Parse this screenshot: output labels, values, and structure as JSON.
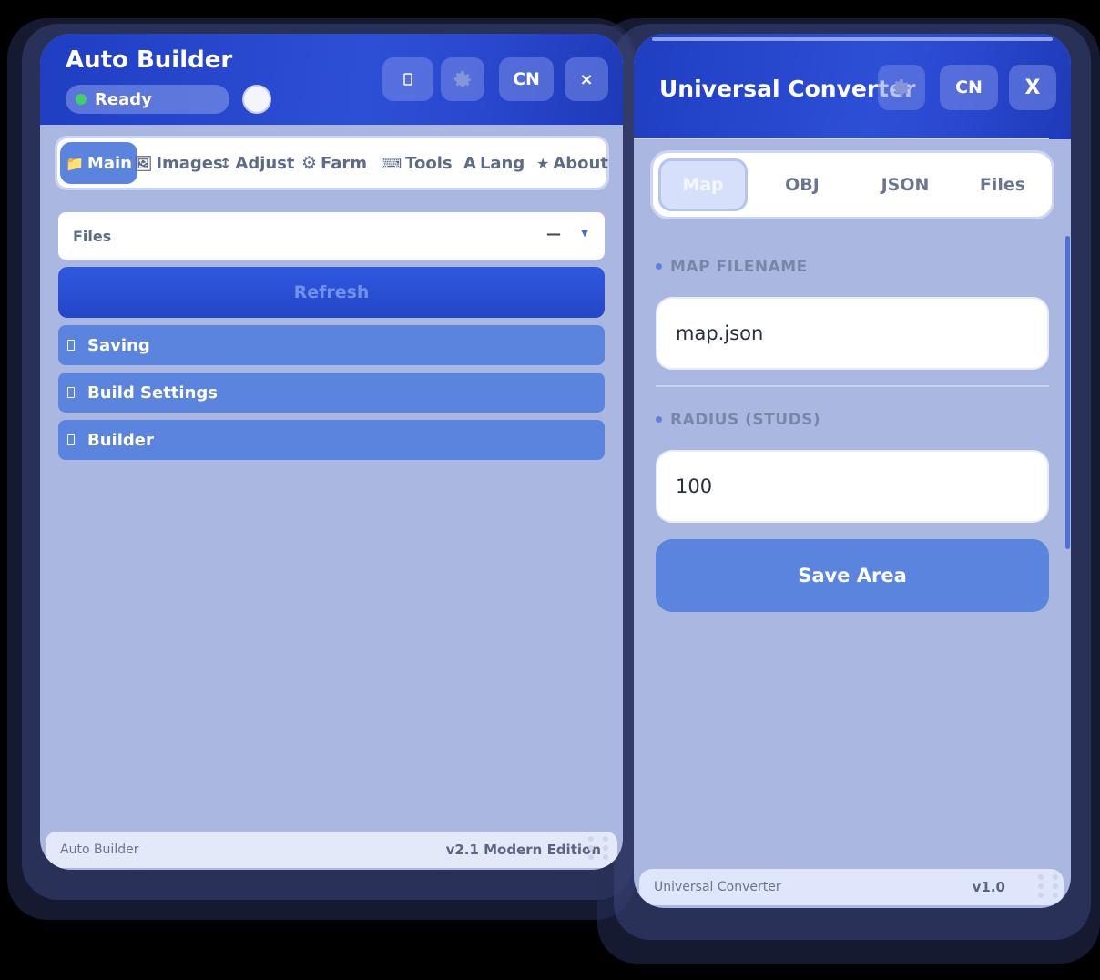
{
  "left_window": {
    "title": "Auto Builder",
    "status": "Ready",
    "header_buttons": {
      "mobile_icon": "phone-icon",
      "settings_icon": "gear-icon",
      "lang": "CN",
      "close": "×"
    },
    "tabs": [
      {
        "icon": "📁",
        "label": "Main",
        "active": true
      },
      {
        "icon": "🖼",
        "label": "Images",
        "active": false
      },
      {
        "icon": "↕",
        "label": "Adjust",
        "active": false
      },
      {
        "icon": "⚙",
        "label": "Farm",
        "active": false
      },
      {
        "icon": "⌨",
        "label": "Tools",
        "active": false
      },
      {
        "icon": "A",
        "label": "Lang",
        "active": false
      },
      {
        "icon": "★",
        "label": "About",
        "active": false
      }
    ],
    "files_select": {
      "label": "Files",
      "value": "—"
    },
    "refresh_label": "Refresh",
    "sections": [
      "Saving",
      "Build Settings",
      "Builder"
    ],
    "footer": {
      "name": "Auto Builder",
      "version": "v2.1 Modern Edition"
    }
  },
  "right_window": {
    "title": "Universal Converter",
    "header_buttons": {
      "settings_icon": "gear-icon",
      "lang": "CN",
      "close": "X"
    },
    "tabs": [
      {
        "label": "Map",
        "active": true
      },
      {
        "label": "OBJ",
        "active": false
      },
      {
        "label": "JSON",
        "active": false
      },
      {
        "label": "Files",
        "active": false
      }
    ],
    "fields": {
      "map_filename": {
        "label": "MAP FILENAME",
        "value": "map.json"
      },
      "radius": {
        "label": "RADIUS (STUDS)",
        "value": "100"
      }
    },
    "save_label": "Save Area",
    "footer": {
      "name": "Universal Converter",
      "version": "v1.0"
    }
  },
  "colors": {
    "header_blue": "#2446c8",
    "panel_bg": "#aab8e1",
    "accent": "#5a84de",
    "status_green": "#3fd06a"
  }
}
